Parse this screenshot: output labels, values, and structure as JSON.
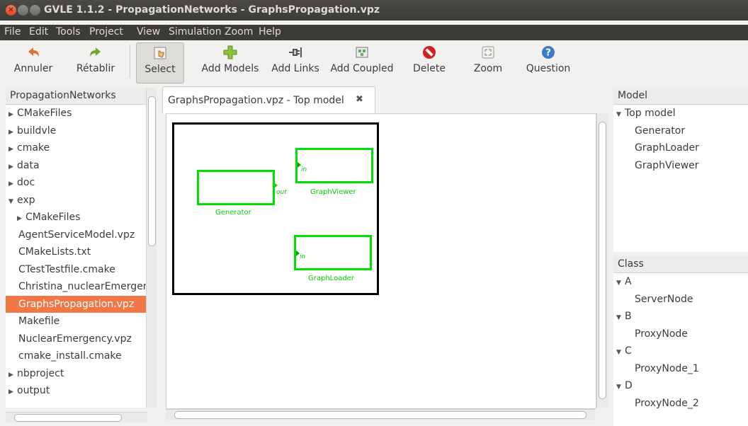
{
  "window": {
    "title": "GVLE 1.1.2 - PropagationNetworks - GraphsPropagation.vpz"
  },
  "menu": [
    "File",
    "Edit",
    "Tools",
    "Project",
    "View",
    "Simulation",
    "Zoom",
    "Help"
  ],
  "toolbar": {
    "undo": "Annuler",
    "redo": "Rétablir",
    "select": "Select",
    "add_models": "Add Models",
    "add_links": "Add Links",
    "add_coupled": "Add Coupled",
    "delete": "Delete",
    "zoom": "Zoom",
    "question": "Question"
  },
  "project": {
    "header": "PropagationNetworks",
    "items": [
      {
        "label": "CMakeFiles",
        "arrow": "▶",
        "indent": 0
      },
      {
        "label": "buildvle",
        "arrow": "▶",
        "indent": 0
      },
      {
        "label": "cmake",
        "arrow": "▶",
        "indent": 0
      },
      {
        "label": "data",
        "arrow": "▶",
        "indent": 0
      },
      {
        "label": "doc",
        "arrow": "▶",
        "indent": 0
      },
      {
        "label": "exp",
        "arrow": "▼",
        "indent": 0
      },
      {
        "label": "CMakeFiles",
        "arrow": "▶",
        "indent": 1
      },
      {
        "label": "AgentServiceModel.vpz",
        "arrow": "",
        "indent": 1
      },
      {
        "label": "CMakeLists.txt",
        "arrow": "",
        "indent": 1
      },
      {
        "label": "CTestTestfile.cmake",
        "arrow": "",
        "indent": 1
      },
      {
        "label": "Christina_nuclearEmergency.vpz",
        "arrow": "",
        "indent": 1
      },
      {
        "label": "GraphsPropagation.vpz",
        "arrow": "",
        "indent": 1,
        "selected": true
      },
      {
        "label": "Makefile",
        "arrow": "",
        "indent": 1
      },
      {
        "label": "NuclearEmergency.vpz",
        "arrow": "",
        "indent": 1
      },
      {
        "label": "cmake_install.cmake",
        "arrow": "",
        "indent": 1
      },
      {
        "label": "nbproject",
        "arrow": "▶",
        "indent": 0
      },
      {
        "label": "output",
        "arrow": "▶",
        "indent": 0
      }
    ]
  },
  "editor": {
    "tab_label": "GraphsPropagation.vpz - Top model",
    "models": {
      "generator": {
        "name": "Generator",
        "port": "out"
      },
      "viewer": {
        "name": "GraphViewer",
        "port": "in"
      },
      "loader": {
        "name": "GraphLoader",
        "port": "in"
      }
    }
  },
  "model_panel": {
    "header": "Model",
    "root": "Top model",
    "children": [
      "Generator",
      "GraphLoader",
      "GraphViewer"
    ]
  },
  "class_panel": {
    "header": "Class",
    "groups": [
      {
        "name": "A",
        "item": "ServerNode"
      },
      {
        "name": "B",
        "item": "ProxyNode"
      },
      {
        "name": "C",
        "item": "ProxyNode_1"
      },
      {
        "name": "D",
        "item": "ProxyNode_2"
      }
    ]
  },
  "colors": {
    "selection": "#f07746",
    "model_border": "#00e000"
  }
}
